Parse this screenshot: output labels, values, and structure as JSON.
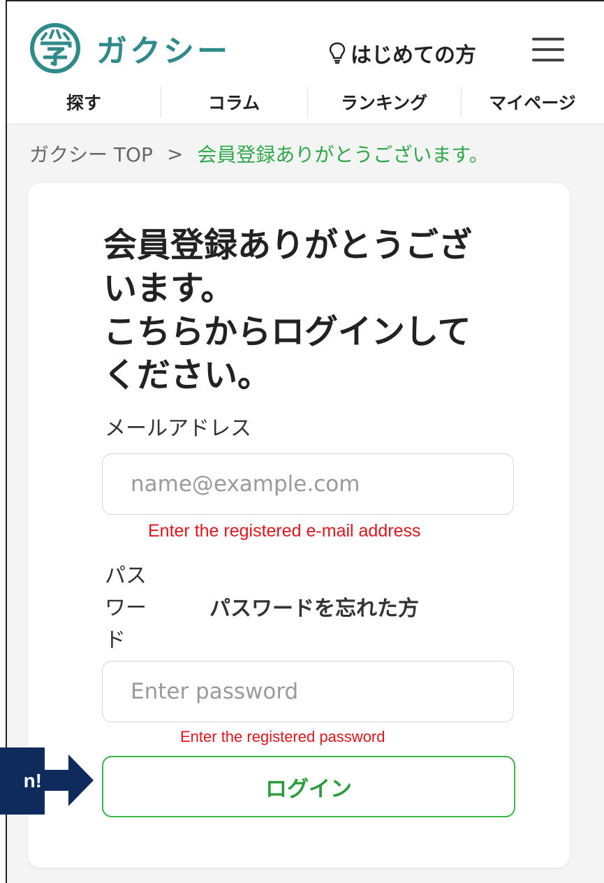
{
  "header": {
    "logo_text": "ガクシー",
    "beginner_link": "はじめての方",
    "nav": [
      "探す",
      "コラム",
      "ランキング",
      "マイページ"
    ]
  },
  "breadcrumb": {
    "home": "ガクシー TOP",
    "separator": ">",
    "current": "会員登録ありがとうございます。"
  },
  "form": {
    "title": "会員登録ありがとうござ\nいます。\nこちらからログインして\nください。",
    "email_label": "メールアドレス",
    "email_placeholder": "name@example.com",
    "password_label": "パス\nワー\nド",
    "forgot_password": "パスワードを忘れた方",
    "password_placeholder": "Enter password",
    "login_button": "ログイン"
  },
  "annotations": {
    "email_hint": "Enter the registered e-mail address",
    "password_hint": "Enter the registered password",
    "callout_text": "n!"
  },
  "colors": {
    "brand": "#2f8a8a",
    "accent_green": "#39b54a",
    "annotation_red": "#e0141b",
    "callout_navy": "#0f2a5c"
  }
}
